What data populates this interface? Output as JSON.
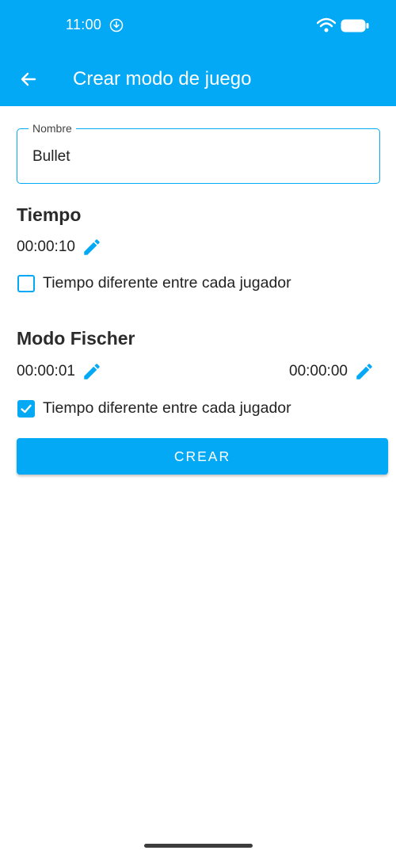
{
  "status_bar": {
    "time": "11:00"
  },
  "app_bar": {
    "title": "Crear modo de juego",
    "background": "#03A9F4"
  },
  "name_field": {
    "label": "Nombre",
    "value": "Bullet"
  },
  "tiempo": {
    "title": "Tiempo",
    "time": "00:00:10",
    "checkbox_label": "Tiempo diferente entre cada jugador",
    "checked": false
  },
  "fischer": {
    "title": "Modo Fischer",
    "time_player1": "00:00:01",
    "time_player2": "00:00:00",
    "checkbox_label": "Tiempo diferente entre cada jugador",
    "checked": true
  },
  "create_button": {
    "label": "CREAR"
  },
  "accent_color": "#03A9F4",
  "icons": [
    "arrow-back-icon",
    "pencil-icon",
    "checkbox-icon",
    "download-icon",
    "wifi-icon",
    "battery-icon"
  ]
}
